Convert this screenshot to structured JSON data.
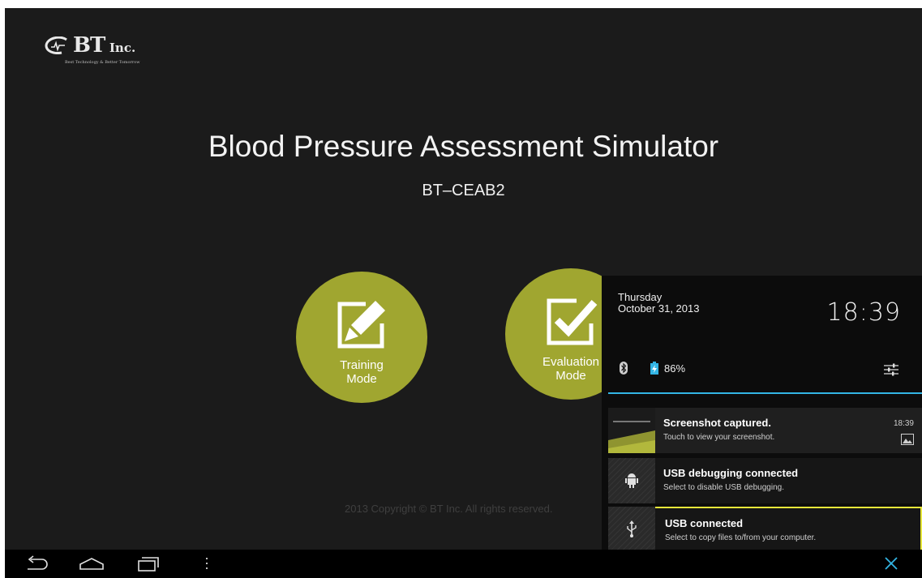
{
  "logo": {
    "brand": "BT",
    "brand_suffix": "Inc.",
    "tagline": "Best Technology & Better Tomorrow"
  },
  "app": {
    "title": "Blood Pressure Assessment Simulator",
    "model": "BT–CEAB2"
  },
  "modes": [
    {
      "label_line1": "Training",
      "label_line2": "Mode",
      "icon": "pencil-icon"
    },
    {
      "label_line1": "Evaluation",
      "label_line2": "Mode",
      "icon": "checkmark-icon"
    }
  ],
  "footer": {
    "copyright": "2013 Copyright © BT Inc. All rights reserved."
  },
  "shade": {
    "day": "Thursday",
    "date": "October 31, 2013",
    "clock": "18:39",
    "battery_percent": "86%",
    "accent_color": "#33b5e5",
    "notifications": [
      {
        "title": "Screenshot captured.",
        "subtitle": "Touch to view your screenshot.",
        "time": "18:39"
      },
      {
        "title": "USB debugging connected",
        "subtitle": "Select to disable USB debugging."
      },
      {
        "title": "USB connected",
        "subtitle": "Select to copy files to/from your computer."
      }
    ]
  },
  "colors": {
    "mode_button": "#a0a630",
    "background": "#1b1b1b",
    "highlight": "#e6e63a"
  },
  "navbar": {
    "icons": [
      "back-icon",
      "home-icon",
      "recents-icon",
      "menu-icon",
      "close-icon"
    ]
  }
}
